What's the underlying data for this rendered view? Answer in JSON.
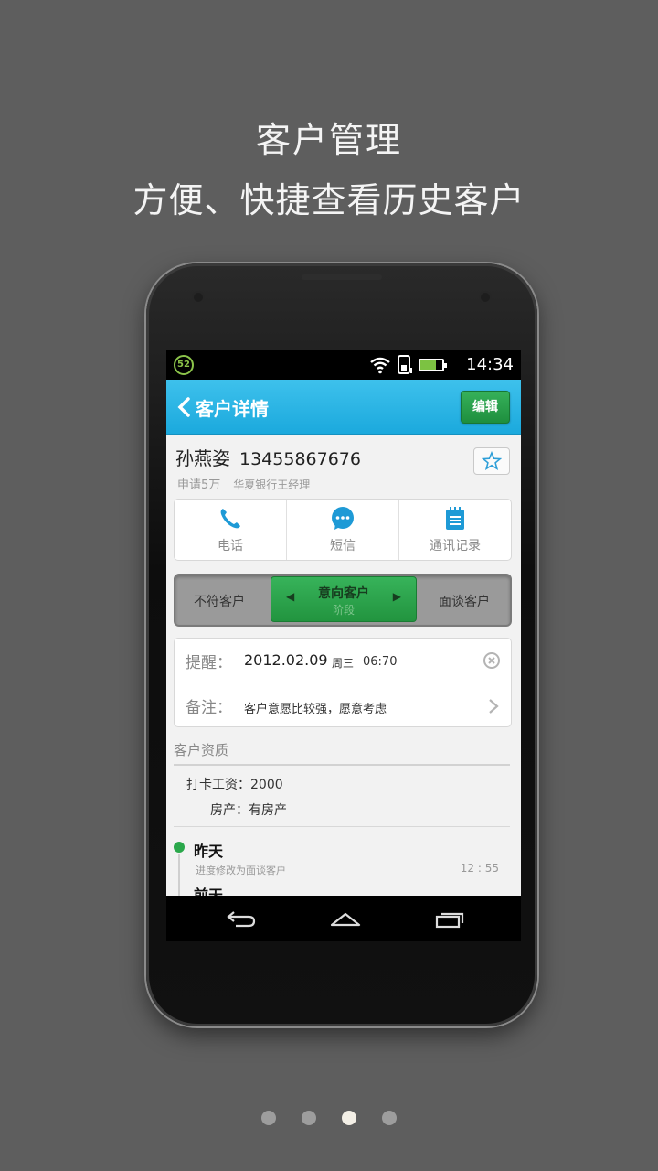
{
  "headline": {
    "line1": "客户管理",
    "line2": "方便、快捷查看历史客户"
  },
  "status_bar": {
    "badge": "52",
    "time": "14:34",
    "icons": [
      "wifi-icon",
      "sim-icon",
      "battery-icon"
    ]
  },
  "title_bar": {
    "title": "客户详情",
    "edit_label": "编辑"
  },
  "customer": {
    "name": "孙燕姿",
    "phone": "13455867676",
    "apply": "申请5万",
    "bank": "华夏银行王经理"
  },
  "actions": [
    {
      "label": "电话",
      "icon": "phone-icon"
    },
    {
      "label": "短信",
      "icon": "sms-icon"
    },
    {
      "label": "通讯记录",
      "icon": "log-icon"
    }
  ],
  "stage": {
    "left": "不符客户",
    "current": "意向客户",
    "current_sub": "阶段",
    "right": "面谈客户"
  },
  "reminder": {
    "label": "提醒：",
    "date": "2012.02.09",
    "weekday": "周三",
    "time": "06:70"
  },
  "note": {
    "label": "备注：",
    "text": "客户意愿比较强，愿意考虑"
  },
  "qualification": {
    "title": "客户资质",
    "salary": "打卡工资：2000",
    "property": "房产：有房产"
  },
  "timeline": {
    "day": "昨天",
    "desc": "进度修改为面谈客户",
    "time": "12 : 55",
    "next_day": "前天"
  },
  "pager": {
    "count": 4,
    "active_index": 2
  },
  "colors": {
    "background": "#5e5e5e",
    "title_bar": "#1ba9dd",
    "accent_green": "#22943f"
  }
}
